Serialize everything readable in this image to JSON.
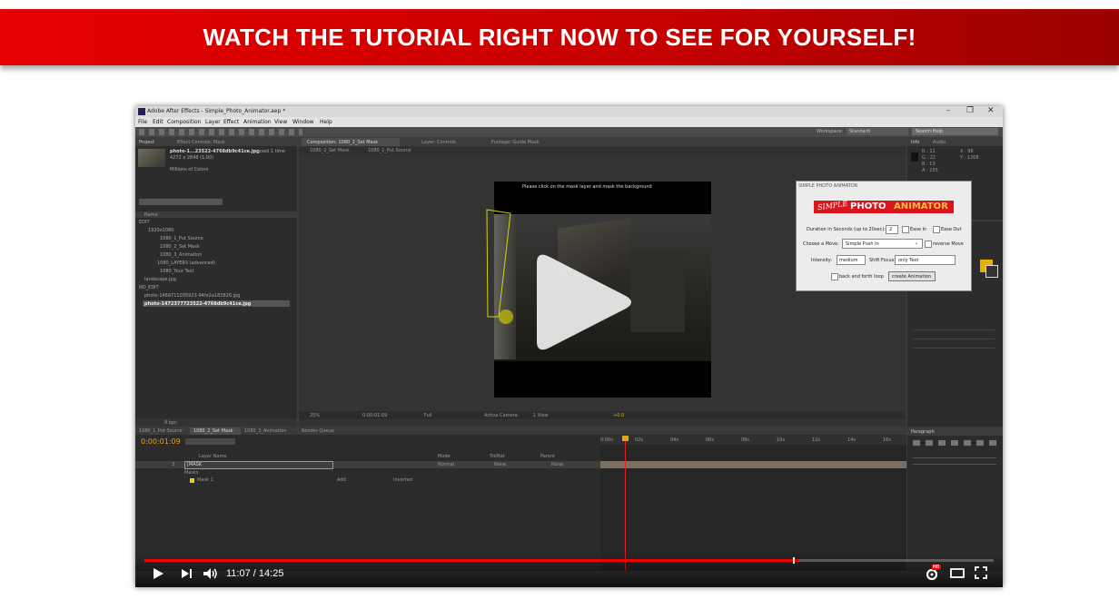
{
  "banner": {
    "text": "WATCH THE TUTORIAL RIGHT NOW TO SEE FOR YOURSELF!"
  },
  "app": {
    "window_title": "Adobe After Effects - Simple_Photo_Animator.aep *",
    "menu": [
      "File",
      "Edit",
      "Composition",
      "Layer",
      "Effect",
      "Animation",
      "View",
      "Window",
      "Help"
    ],
    "workspace_label": "Workspace:",
    "workspace_value": "Standard",
    "search_help": "Search Help"
  },
  "project_panel": {
    "tab": "Project",
    "tab2": "Effect Controls: Mask",
    "file_name": "photo-1...23522-4768db9c41ce.jpg",
    "file_used": ", used 1 time",
    "file_dims": "4272 x 2848 (1.00)",
    "file_colors": "Millions of Colors",
    "column_name": "Name",
    "items": [
      "EDIT",
      "1920x1080",
      "1080_1_Put Source",
      "1080_2_Set Mask",
      "1080_3_Animation",
      "1080_LAYERS (advanced)",
      "1080_Your Text",
      "landscape.jpg",
      "NO_EDIT",
      "photo-1469711035923-94fe2a183826.jpg",
      "photo-1472377723522-4768db9c41ce.jpg"
    ],
    "bpc": "8 bpc"
  },
  "comp_panel": {
    "tab": "Composition: 1080_2_Set Mask",
    "tab2": "Layer: Controls",
    "tab3": "Footage: Guide Mask",
    "subtabs": [
      "1080_2_Set Mask",
      "1080_1_Put Source"
    ],
    "instruction": "Please click on the mask layer and mask the background",
    "zoom": "25%",
    "timecode": "0:00:01:09",
    "res": "Full",
    "camera": "Active Camera",
    "view": "1 View",
    "offset": "+0.0"
  },
  "info_panel": {
    "tabs": [
      "Info",
      "Audio"
    ],
    "r": "R : 11",
    "g": "G : 22",
    "b": "B : 13",
    "a": "A : 255",
    "x": "X : 96",
    "y": "Y : 1208"
  },
  "spa_dialog": {
    "title": "SIMPLE PHOTO ANIMATOR",
    "logo_script": "SIMPLE",
    "logo_text_a": "PHOTO",
    "logo_text_b": "ANIMATOR",
    "duration_label": "Duration in Seconds (up to 20sec):",
    "duration_value": "2",
    "ease_in": "Ease In",
    "ease_out": "Ease Out",
    "move_label": "Choose a Move:",
    "move_value": "Simple Push In",
    "reverse": "reverse Move",
    "intensity_label": "Intensity:",
    "intensity_value": "medium",
    "shift_label": "Shift Focus:",
    "shift_value": "only Text",
    "loop_label": "back and forth loop",
    "create_button": "create Animation"
  },
  "timeline": {
    "tabs": [
      "1080_1_Put Source",
      "1080_2_Set Mask",
      "1080_3_Animation",
      "Render Queue"
    ],
    "timecode": "0:00:01:09",
    "layer_header": "Layer Name",
    "mode_header": "Mode",
    "trkmat_header": "TrkMat",
    "parent_header": "Parent",
    "layer_num": "3",
    "layer_name": "[MASK",
    "mode_value": "Normal",
    "trkmat_value": "None",
    "parent_value": "None",
    "masks_label": "Masks",
    "mask1_label": "Mask 1",
    "mask_mode": "Add",
    "inverted": "Inverted",
    "ruler": [
      "0:00s",
      "02s",
      "04s",
      "06s",
      "08s",
      "10s",
      "12s",
      "14s",
      "16s"
    ],
    "paragraph_tab": "Paragraph",
    "toggle": "Toggle Switches / Modes"
  },
  "video": {
    "current_time": "11:07",
    "duration": "14:25",
    "progress": 0.77,
    "hd_badge": "HD"
  },
  "colors": {
    "banner": "#e60000",
    "progress": "#ee0000",
    "accent_orange": "#e8a317"
  }
}
